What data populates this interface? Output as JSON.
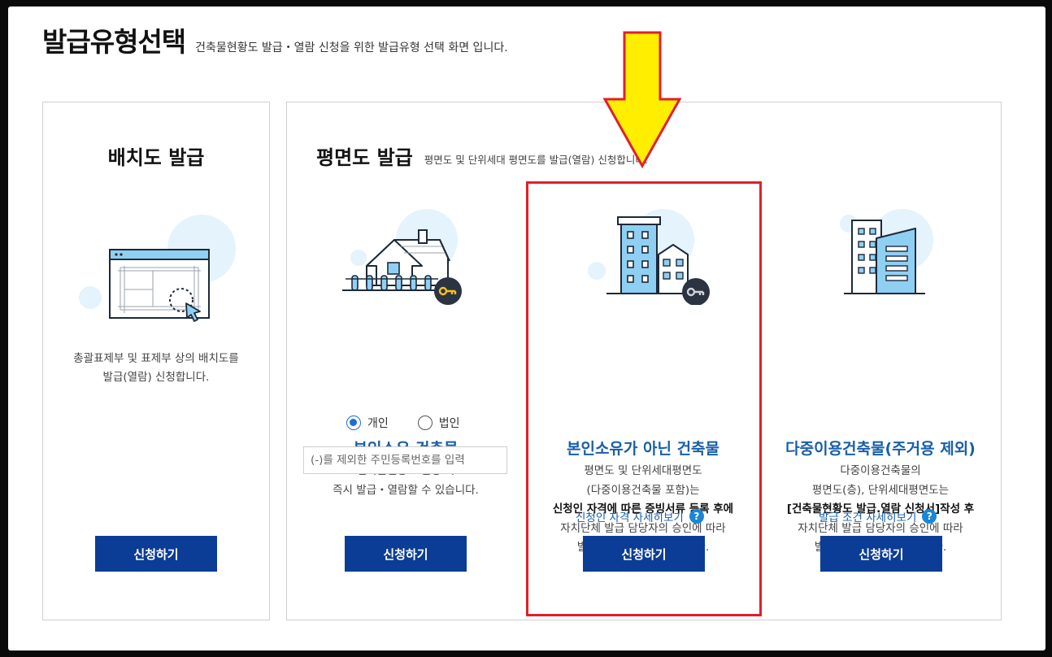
{
  "header": {
    "title": "발급유형선택",
    "subtitle": "건축물현황도 발급・열람 신청을 위한 발급유형 선택 화면 입니다."
  },
  "site_plan": {
    "title": "배치도 발급",
    "desc_line1": "총괄표제부 및 표제부 상의 배치도를",
    "desc_line2": "발급(열람) 신청합니다.",
    "apply_label": "신청하기"
  },
  "floor_plan": {
    "title": "평면도 발급",
    "subtitle": "평면도 및 단위세대 평면도를 발급(열람) 신청합니다.",
    "owned": {
      "title": "본인소유 건축물",
      "desc_line1": "건축물현황도 신청 시",
      "desc_line2": "즉시 발급・열람할 수 있습니다.",
      "radio_individual": "개인",
      "radio_corporate": "법인",
      "id_placeholder": "(-)를 제외한 주민등록번호를 입력",
      "apply_label": "신청하기"
    },
    "not_owned": {
      "title": "본인소유가 아닌 건축물",
      "desc_line1": "평면도 및 단위세대평면도",
      "desc_line2": "(다중이용건축물 포함)는",
      "desc_line3": "신청인 자격에 따른 증빙서류 등록 후에",
      "desc_line4": "자치단체 발급 담당자의 승인에 따라",
      "desc_line5": "발급, 열람 받을 수 있습니다.",
      "detail_link": "신청인 자격 자세히보기",
      "apply_label": "신청하기"
    },
    "multi_use": {
      "title": "다중이용건축물(주거용 제외)",
      "desc_line1": "다중이용건축물의",
      "desc_line2": "평면도(층), 단위세대평면도는",
      "desc_line3": "[건축물현황도 발급.열람 신청서]작성 후",
      "desc_line4": "자치단체 발급 담당자의 승인에 따라",
      "desc_line5": "발급. 열람 받을 수 있습니다.",
      "detail_link": "발급 조건 자세히보기",
      "apply_label": "신청하기"
    }
  },
  "help_glyph": "?",
  "colors": {
    "primary_button": "#0b3d96",
    "title_blue": "#1a5fa8",
    "highlight_red": "#e0202a",
    "arrow_yellow": "#ffee00"
  },
  "icons": [
    "window-cursor-icon",
    "house-key-icon",
    "building-key-icon",
    "office-building-icon",
    "help-icon",
    "down-arrow-annotation"
  ]
}
